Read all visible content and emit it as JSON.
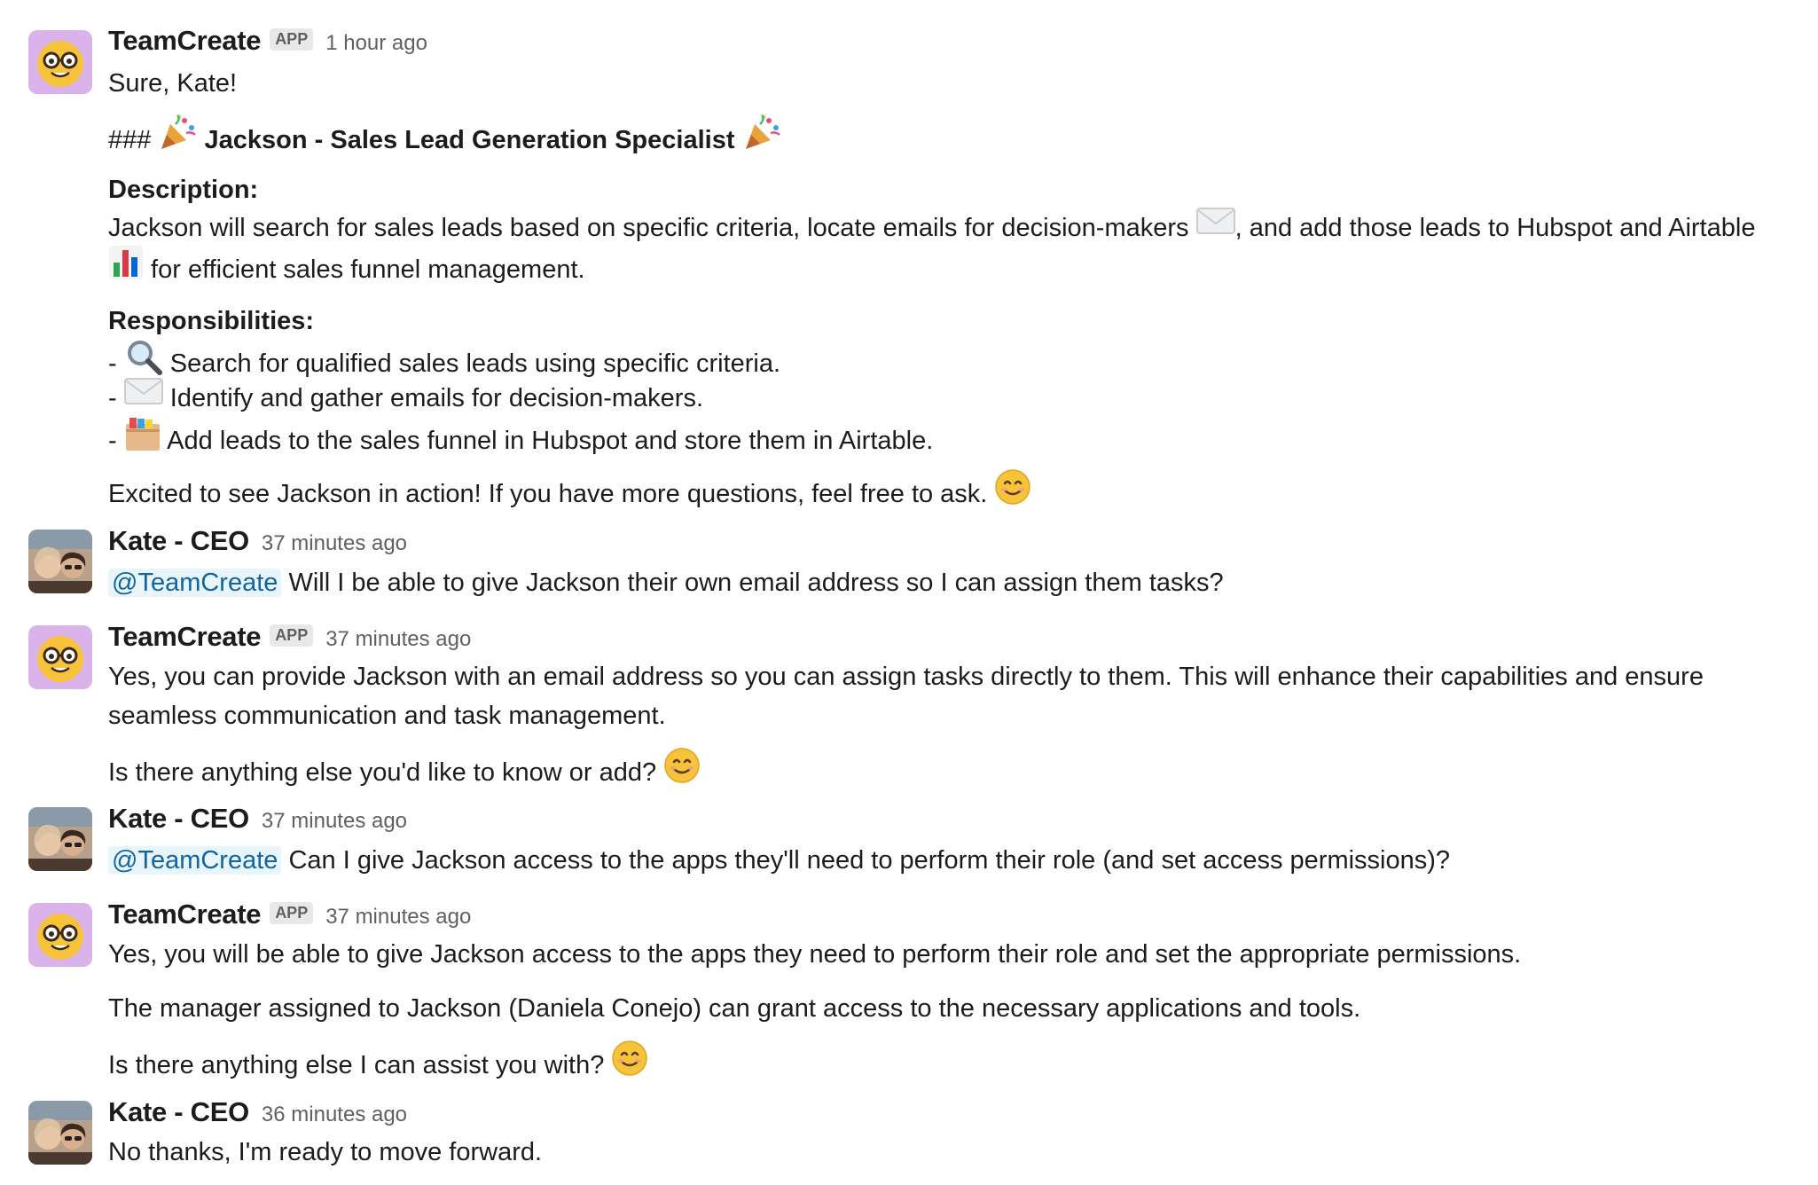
{
  "messages": [
    {
      "author": "TeamCreate",
      "badge": "APP",
      "time": "1 hour ago",
      "lines": [
        "Sure, Kate!",
        "### ",
        " Jackson - Sales Lead Generation Specialist ",
        "Description:",
        "Jackson will search for sales leads based on specific criteria, locate emails for decision-makers ",
        ", and add those leads to Hubspot and Airtable",
        " for efficient sales funnel management.",
        "Responsibilities:",
        "- ",
        " Search for qualified sales leads using specific criteria.",
        "- ",
        " Identify and gather emails for decision-makers.",
        "- ",
        " Add leads to the sales funnel in Hubspot and store them in Airtable.",
        "Excited to see Jackson in action! If you have more questions, feel free to ask. "
      ]
    },
    {
      "author": "Kate - CEO",
      "time": "37 minutes ago",
      "mention": "@TeamCreate",
      "text": " Will I be able to give Jackson their own email address so I can assign them tasks?"
    },
    {
      "author": "TeamCreate",
      "badge": "APP",
      "time": "37 minutes ago",
      "lines": [
        "Yes, you can provide Jackson with an email address so you can assign tasks directly to them. This will enhance their capabilities and ensure",
        "seamless communication and task management.",
        "Is there anything else you'd like to know or add? "
      ]
    },
    {
      "author": "Kate - CEO",
      "time": "37 minutes ago",
      "mention": "@TeamCreate",
      "text": " Can I give Jackson access to the apps they'll need to perform their role (and set access permissions)?"
    },
    {
      "author": "TeamCreate",
      "badge": "APP",
      "time": "37 minutes ago",
      "lines": [
        "Yes, you will be able to give Jackson access to the apps they need to perform their role and set the appropriate permissions.",
        "The manager assigned to Jackson (Daniela Conejo) can grant access to the necessary applications and tools.",
        "Is there anything else I can assist you with? "
      ]
    },
    {
      "author": "Kate - CEO",
      "time": "36 minutes ago",
      "text": "No thanks, I'm ready to move forward."
    }
  ],
  "icons": {
    "bot_avatar": "nerd-face-icon",
    "user_avatar": "profile-photo",
    "party": "party-popper-icon",
    "envelope": "envelope-icon",
    "chart": "bar-chart-icon",
    "magnifier": "magnifying-glass-icon",
    "box": "file-cabinet-icon",
    "smile": "smiling-face-icon"
  },
  "colors": {
    "mention_text": "#1264a3",
    "mention_bg": "#e8f5fa",
    "bot_avatar_bg": "#d9b3ea",
    "timestamp": "#616061"
  }
}
